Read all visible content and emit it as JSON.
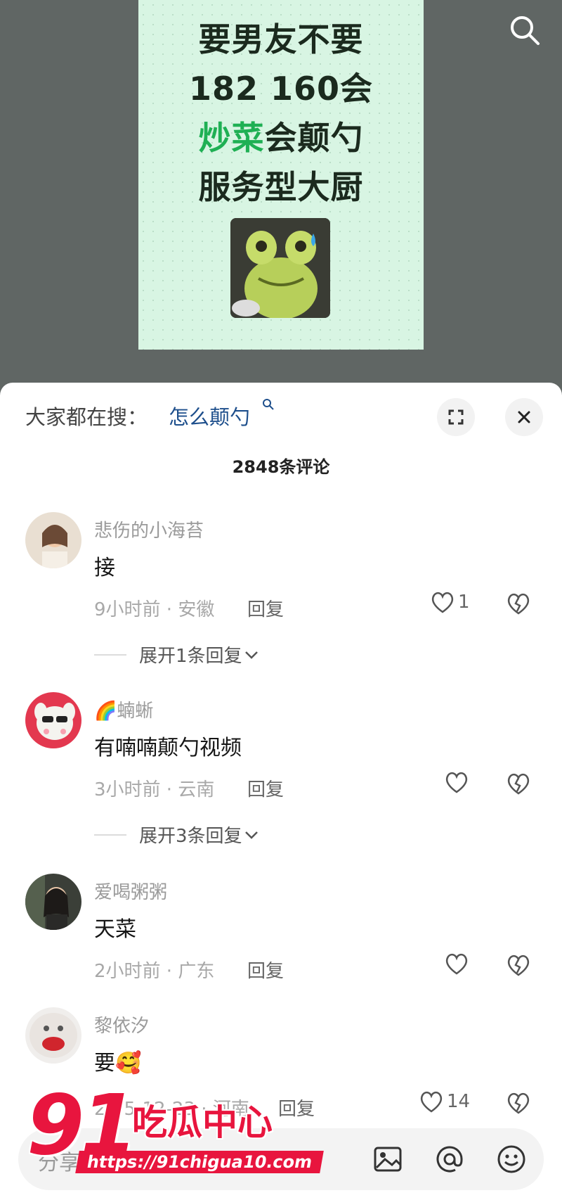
{
  "poster": {
    "line1": "要男友不要",
    "line2": "182 160会",
    "line3_green": "炒菜",
    "line3_rest": "会颠勺",
    "line4": "服务型大厨"
  },
  "header": {
    "hot_label": "大家都在搜：",
    "hot_term": "怎么颠勺"
  },
  "comment_count": "2848条评论",
  "comments": [
    {
      "user": "悲伤的小海苔",
      "text": "接",
      "meta": "9小时前 · 安徽",
      "reply": "回复",
      "likes": "1",
      "expand": "展开1条回复"
    },
    {
      "user": "🌈蝻蜥",
      "text": "有喃喃颠勺视频",
      "meta": "3小时前 · 云南",
      "reply": "回复",
      "likes": "",
      "expand": "展开3条回复"
    },
    {
      "user": "爱喝粥粥",
      "text": "天菜",
      "meta": "2小时前 · 广东",
      "reply": "回复",
      "likes": "",
      "expand": ""
    },
    {
      "user": "黎依汐",
      "text": "要🥰",
      "meta": "2…5-12-23 · 河南",
      "reply": "回复",
      "likes": "14",
      "expand": ""
    }
  ],
  "input": {
    "placeholder": "分享…"
  },
  "watermark": {
    "num": "91",
    "cn": "吃瓜中心",
    "url": "https://91chigua10.com"
  },
  "colors": {
    "accent_red": "#e8153e",
    "link_blue": "#1e4f8c",
    "poster_green": "#1fb054"
  }
}
